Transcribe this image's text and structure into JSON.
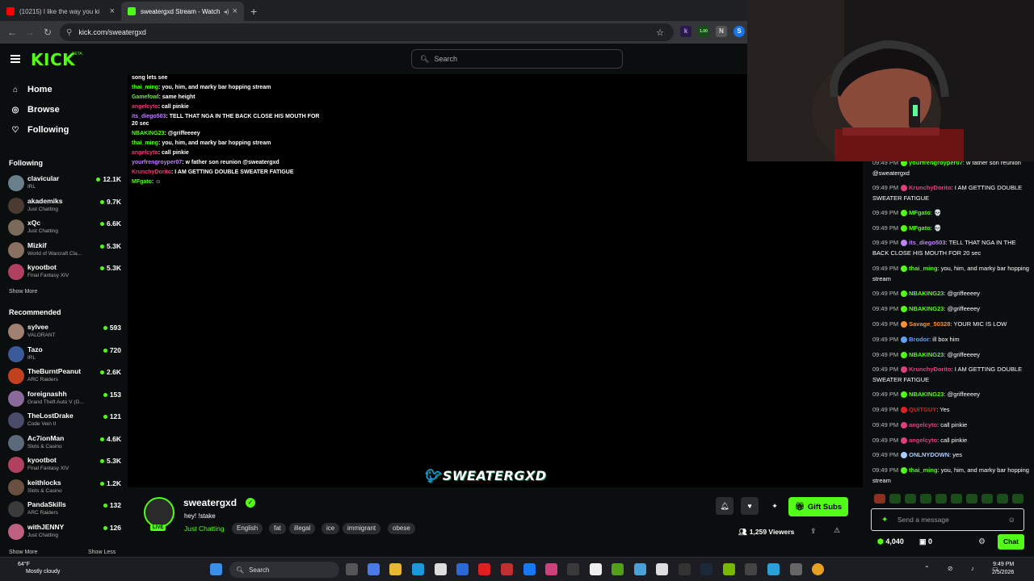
{
  "browser": {
    "tabs": [
      {
        "title": "(10215) I like the way you ki",
        "icon_color": "#ff0000"
      },
      {
        "title": "sweatergxd Stream - Watch",
        "icon_color": "#53fc18"
      }
    ],
    "new_tab_symbol": "+",
    "url": "kick.com/sweatergxd",
    "extensions": [
      "k",
      "1.00",
      "N",
      "S"
    ]
  },
  "header": {
    "logo": "KICK",
    "beta": "BETA",
    "search_placeholder": "Search"
  },
  "sidebar": {
    "nav": [
      {
        "label": "Home",
        "icon": "home-icon"
      },
      {
        "label": "Browse",
        "icon": "compass-icon"
      },
      {
        "label": "Following",
        "icon": "heart-icon"
      }
    ],
    "following_title": "Following",
    "following": [
      {
        "name": "clavicular",
        "category": "IRL",
        "viewers": "12.1K",
        "color": "#6a7f8c"
      },
      {
        "name": "akademiks",
        "category": "Just Chatting",
        "viewers": "9.7K",
        "color": "#4a3a30"
      },
      {
        "name": "xQc",
        "category": "Just Chatting",
        "viewers": "6.6K",
        "color": "#7a6a5a"
      },
      {
        "name": "Mizkif",
        "category": "World of Warcraft Cla...",
        "viewers": "5.3K",
        "color": "#8a7060"
      },
      {
        "name": "kyootbot",
        "category": "Final Fantasy XIV",
        "viewers": "5.3K",
        "color": "#b04060"
      }
    ],
    "show_more": "Show More",
    "recommended_title": "Recommended",
    "recommended": [
      {
        "name": "sylvee",
        "category": "VALORANT",
        "viewers": "593",
        "color": "#a08070"
      },
      {
        "name": "Tazo",
        "category": "IRL",
        "viewers": "720",
        "color": "#3a5a9a"
      },
      {
        "name": "TheBurntPeanut",
        "category": "ARC Raiders",
        "viewers": "2.6K",
        "color": "#c04020"
      },
      {
        "name": "foreignashh",
        "category": "Grand Theft Auto V (G...",
        "viewers": "153",
        "color": "#8a6a9a"
      },
      {
        "name": "TheLostDrake",
        "category": "Code Vein II",
        "viewers": "121",
        "color": "#4a4a6a"
      },
      {
        "name": "Ac7ionMan",
        "category": "Slots & Casino",
        "viewers": "4.6K",
        "color": "#5a6a7a"
      },
      {
        "name": "kyootbot",
        "category": "Final Fantasy XIV",
        "viewers": "5.3K",
        "color": "#b04060"
      },
      {
        "name": "keithlocks",
        "category": "Slots & Casino",
        "viewers": "1.2K",
        "color": "#6a5040"
      },
      {
        "name": "PandaSkills",
        "category": "ARC Raiders",
        "viewers": "132",
        "color": "#3a3a3a"
      },
      {
        "name": "withJENNY",
        "category": "Just Chatting",
        "viewers": "126",
        "color": "#c06080"
      }
    ],
    "show_more_2": "Show More",
    "show_less": "Show Less"
  },
  "video_overlay": [
    {
      "user": "",
      "text": "song lets see",
      "color": "#ffffff"
    },
    {
      "user": "thai_ming",
      "text": ": you, him, and marky bar hopping stream",
      "color": "#53fc18"
    },
    {
      "user": "Gamefowl",
      "text": ": same height",
      "color": "#53fc18"
    },
    {
      "user": "angelcyto",
      "text": ": call pinkie",
      "color": "#e0407a"
    },
    {
      "user": "its_diego503",
      "text": ": TELL THAT NGA IN THE BACK CLOSE HIS MOUTH FOR 20 sec",
      "color": "#c080ff"
    },
    {
      "user": "NBAKING23",
      "text": ": @griffeeeey",
      "color": "#53fc18"
    },
    {
      "user": "thai_ming",
      "text": ": you, him, and marky bar hopping stream",
      "color": "#53fc18"
    },
    {
      "user": "angelcyto",
      "text": ": call pinkie",
      "color": "#e0407a"
    },
    {
      "user": "yourfrengroyper07",
      "text": ": w father son reunion @sweatergxd",
      "color": "#c080ff"
    },
    {
      "user": "KrunchyDorito",
      "text": ": I AM GETTING DOUBLE SWEATER FATIGUE",
      "color": "#e0407a"
    },
    {
      "user": "MFgato",
      "text": ": ☺",
      "color": "#53fc18"
    }
  ],
  "watermark": "SWEATERGXD",
  "stream": {
    "name": "sweatergxd",
    "title": "hey! !stake",
    "category": "Just Chatting",
    "tags": [
      "English",
      "fat",
      "illegal",
      "ice",
      "immigrant",
      "obese"
    ],
    "live_label": "LIVE",
    "gift_label": "Gift Subs",
    "viewers": "1,259 Viewers"
  },
  "chat": {
    "messages": [
      {
        "time": "09:49 PM",
        "user": "yourfrengroyper07",
        "text": ": w father son reunion @sweatergxd",
        "color": "#53fc18"
      },
      {
        "time": "09:49 PM",
        "user": "KrunchyDorito",
        "text": ": I AM GETTING DOUBLE SWEATER FATIGUE",
        "color": "#e0407a"
      },
      {
        "time": "09:49 PM",
        "user": "MFgato",
        "text": ": 💀",
        "color": "#53fc18"
      },
      {
        "time": "09:49 PM",
        "user": "MFgato",
        "text": ": 💀",
        "color": "#53fc18"
      },
      {
        "time": "09:49 PM",
        "user": "its_diego503",
        "text": ": TELL THAT NGA IN THE BACK CLOSE HIS MOUTH FOR 20 sec",
        "color": "#c080ff"
      },
      {
        "time": "09:49 PM",
        "user": "thai_ming",
        "text": ": you, him, and marky bar hopping stream",
        "color": "#53fc18"
      },
      {
        "time": "09:49 PM",
        "user": "NBAKING23",
        "text": ": @griffeeeey",
        "color": "#53fc18"
      },
      {
        "time": "09:49 PM",
        "user": "NBAKING23",
        "text": ": @griffeeeey",
        "color": "#53fc18"
      },
      {
        "time": "09:49 PM",
        "user": "Savage_50328",
        "text": ": YOUR MIC IS LOW",
        "color": "#ff9030"
      },
      {
        "time": "09:49 PM",
        "user": "Brodor",
        "text": ": ill box him",
        "color": "#60a0ff"
      },
      {
        "time": "09:49 PM",
        "user": "NBAKING23",
        "text": ": @griffeeeey",
        "color": "#53fc18"
      },
      {
        "time": "09:49 PM",
        "user": "KrunchyDorito",
        "text": ": I AM GETTING DOUBLE SWEATER FATIGUE",
        "color": "#e0407a"
      },
      {
        "time": "09:49 PM",
        "user": "NBAKING23",
        "text": ": @griffeeeey",
        "color": "#53fc18"
      },
      {
        "time": "09:49 PM",
        "user": "QUITGUY",
        "text": ": Yes",
        "color": "#e02020"
      },
      {
        "time": "09:49 PM",
        "user": "angelcyto",
        "text": ": call pinkie",
        "color": "#e0407a"
      },
      {
        "time": "09:49 PM",
        "user": "angelcyto",
        "text": ": call pinkie",
        "color": "#e0407a"
      },
      {
        "time": "09:49 PM",
        "user": "ONLNYDOWN",
        "text": ": yes",
        "color": "#aaccff"
      },
      {
        "time": "09:49 PM",
        "user": "thai_ming",
        "text": ": you, him, and marky bar hopping stream",
        "color": "#53fc18"
      }
    ],
    "input_placeholder": "Send a message",
    "points": "4,040",
    "count": "0",
    "chat_button": "Chat"
  },
  "taskbar": {
    "temp": "64°F",
    "weather": "Mostly cloudy",
    "search": "Search",
    "time": "9:49 PM",
    "date": "2/5/2026"
  },
  "colors": {
    "accent": "#53fc18",
    "bg": "#0b0e0f"
  }
}
